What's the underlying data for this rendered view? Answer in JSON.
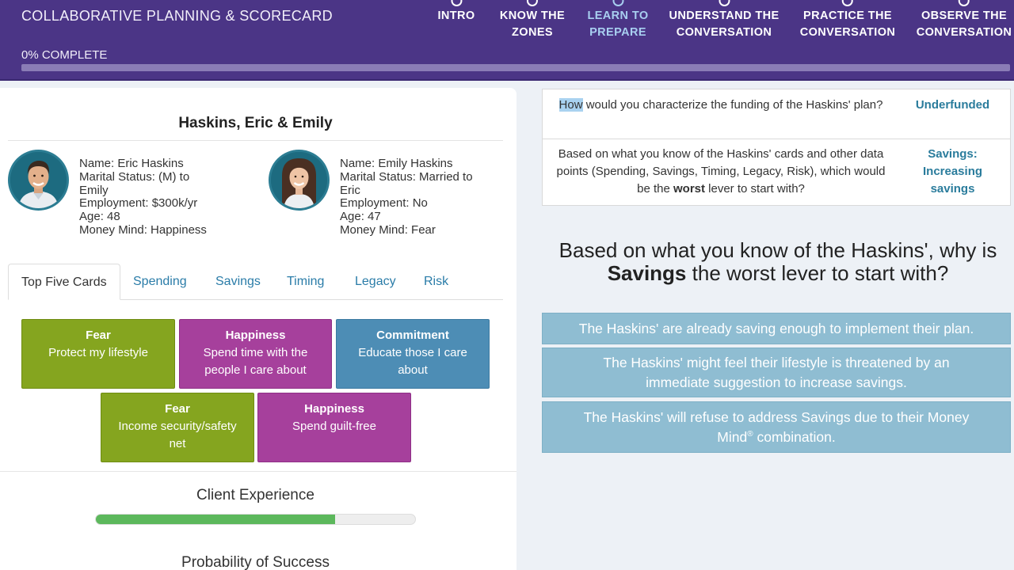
{
  "header": {
    "app_title": "COLLABORATIVE PLANNING & SCORECARD",
    "progress_text": "0% COMPLETE",
    "progress_value": 0,
    "steps": [
      {
        "line1": "INTRO",
        "line2": ""
      },
      {
        "line1": "KNOW THE",
        "line2": "ZONES"
      },
      {
        "line1": "LEARN TO",
        "line2": "PREPARE"
      },
      {
        "line1": "UNDERSTAND THE",
        "line2": "CONVERSATION"
      },
      {
        "line1": "PRACTICE THE",
        "line2": "CONVERSATION"
      },
      {
        "line1": "OBSERVE THE",
        "line2": "CONVERSATION"
      }
    ],
    "active_step": "LEARN TO PREPARE"
  },
  "client": {
    "name": "Haskins, Eric & Emily",
    "people": [
      {
        "avatar": "man-portrait",
        "lines": [
          "Name: Eric Haskins",
          "Marital Status: (M) to",
          "Emily",
          "Employment: $300k/yr",
          "Age: 48",
          "Money Mind: Happiness"
        ]
      },
      {
        "avatar": "woman-portrait",
        "lines": [
          "Name: Emily Haskins",
          "Marital Status: Married to",
          "Eric",
          "Employment: No",
          "Age: 47",
          "Money Mind: Fear"
        ]
      }
    ]
  },
  "tabs": [
    "Top Five Cards",
    "Spending",
    "Savings",
    "Timing",
    "Legacy",
    "Risk"
  ],
  "cards": [
    {
      "title": "Fear",
      "text": "Protect my lifestyle",
      "color": "#85a51f"
    },
    {
      "title": "Happiness",
      "text": "Spend time with the people I care about",
      "color": "#a6409c"
    },
    {
      "title": "Commitment",
      "text": "Educate those I care about",
      "color": "#4d8db5"
    },
    {
      "title": "Fear",
      "text": "Income security/safety net",
      "color": "#85a51f"
    },
    {
      "title": "Happiness",
      "text": "Spend guilt-free",
      "color": "#a6409c"
    }
  ],
  "client_experience": {
    "label": "Client Experience",
    "value": 0.75
  },
  "probability_label": "Probability of Success",
  "qa": [
    {
      "q_highlight": "How",
      "q_rest": " would you characterize the funding of the Haskins' plan?",
      "a": "Underfunded"
    },
    {
      "q_pre": "Based on what you know of the Haskins' cards and other data points (Spending, Savings, Timing, Legacy, Risk), which would be the ",
      "q_bold": "worst",
      "q_post": " lever to start with?",
      "a": "Savings: Increasing savings"
    }
  ],
  "question": {
    "pre": "Based on what you know of the Haskins', why is ",
    "bold": "Savings",
    "post": " the worst lever to start with?"
  },
  "options": [
    {
      "text": "The Haskins' are already saving enough to implement their plan."
    },
    {
      "text": "The Haskins' might feel their lifestyle is threatened by an immediate suggestion to increase savings."
    },
    {
      "text": "The Haskins' will refuse to address Savings due to their Money Mind",
      "sup": "®",
      "tail": " combination."
    }
  ],
  "colors": {
    "header": "#4b3586",
    "accent_link": "#2a7ca8",
    "option_bg": "#8fbdd2",
    "progress_green": "#5cb85c"
  }
}
